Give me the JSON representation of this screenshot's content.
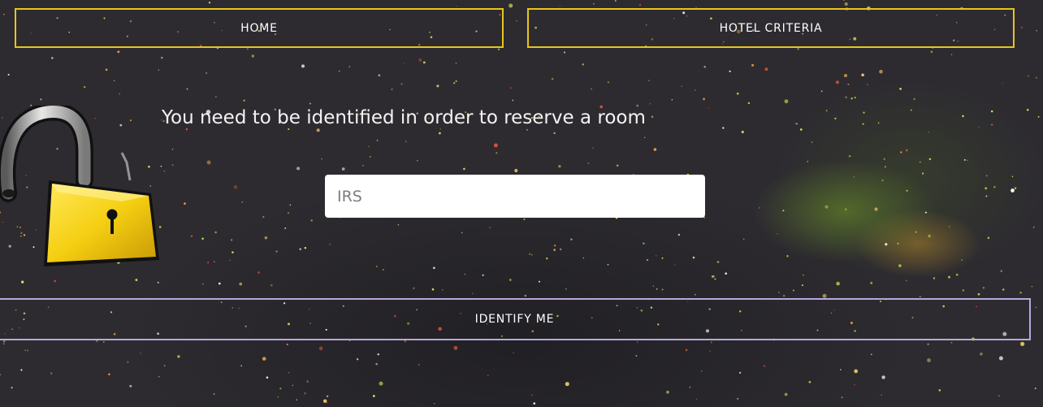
{
  "nav": {
    "home_label": "HOME",
    "criteria_label": "HOTEL CRITERIA"
  },
  "login": {
    "message": "You need to be identified in order to reserve a room",
    "input_placeholder": "IRS",
    "input_value": "",
    "submit_label": "IDENTIFY ME"
  },
  "icons": {
    "lock": "unlocked-padlock-icon"
  },
  "colors": {
    "nav_border": "#e6c51e",
    "submit_border": "#b8a7dd",
    "background": "#2d2b30",
    "lock_body": "#f5d21a"
  }
}
